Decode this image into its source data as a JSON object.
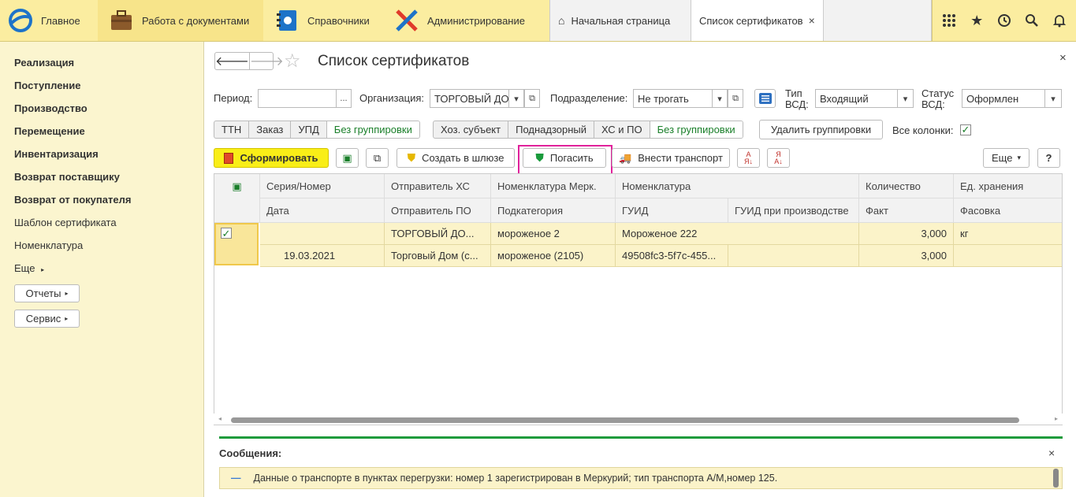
{
  "topbar": {
    "sections": [
      {
        "label": "Главное",
        "icon": "logo-icon"
      },
      {
        "label": "Работа с документами",
        "icon": "briefcase-icon"
      },
      {
        "label": "Справочники",
        "icon": "address-book-icon"
      },
      {
        "label": "Администрирование",
        "icon": "tools-icon"
      }
    ],
    "tabs": {
      "home": "Начальная страница",
      "active": "Список сертификатов"
    }
  },
  "sidebar": {
    "items": [
      "Реализация",
      "Поступление",
      "Производство",
      "Перемещение",
      "Инвентаризация",
      "Возврат поставщику",
      "Возврат от покупателя",
      "Шаблон сертификата",
      "Номенклатура",
      "Еще"
    ],
    "buttons": [
      "Отчеты",
      "Сервис"
    ]
  },
  "main": {
    "title": "Список сертификатов",
    "filters": {
      "period_label": "Период:",
      "period_value": "",
      "period_btn": "...",
      "org_label": "Организация:",
      "org_value": "ТОРГОВЫЙ ДОМ",
      "dept_label": "Подразделение:",
      "dept_value": "Не трогать",
      "type_label_1": "Тип",
      "type_label_2": "ВСД:",
      "type_value": "Входящий",
      "status_label_1": "Статус",
      "status_label_2": "ВСД:",
      "status_value": "Оформлен"
    },
    "group1": [
      "ТТН",
      "Заказ",
      "УПД",
      "Без группировки"
    ],
    "group2": [
      "Хоз. субъект",
      "Поднадзорный",
      "ХС и ПО",
      "Без группировки"
    ],
    "remove_groupings": "Удалить группировки",
    "all_columns": "Все колонки:",
    "toolbar": {
      "generate": "Сформировать",
      "create_gateway": "Создать в шлюзе",
      "redeem": "Погасить",
      "add_transport": "Внести транспорт",
      "more": "Еще",
      "help": "?"
    },
    "table": {
      "headers_row1": [
        "Серия/Номер",
        "Отправитель ХС",
        "Номенклатура Мерк.",
        "Номенклатура",
        "Количество",
        "Ед. хранения"
      ],
      "headers_row2": [
        "Дата",
        "Отправитель ПО",
        "Подкатегория",
        "ГУИД",
        "ГУИД при производстве",
        "Факт",
        "Фасовка"
      ],
      "row1": [
        "",
        "ТОРГОВЫЙ ДО...",
        "мороженое 2",
        "Мороженое 222",
        "3,000",
        "кг"
      ],
      "row2": [
        "19.03.2021",
        "Торговый Дом (с...",
        "мороженое (2105)",
        "49508fc3-5f7c-455...",
        "",
        "3,000",
        ""
      ]
    },
    "messages": {
      "title": "Сообщения:",
      "text": "Данные о транспорте в пунктах перегрузки: номер 1 зарегистрирован в Меркурий; тип транспорта А/М,номер 125."
    }
  }
}
